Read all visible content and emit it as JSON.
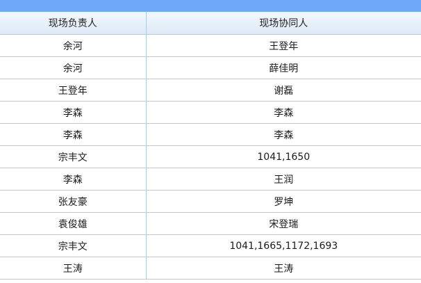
{
  "table": {
    "headers": [
      "现场负责人",
      "现场协同人"
    ],
    "rows": [
      [
        "余河",
        "王登年"
      ],
      [
        "余河",
        "薛佳明"
      ],
      [
        "王登年",
        "谢磊"
      ],
      [
        "李森",
        "李森"
      ],
      [
        "李森",
        "李森"
      ],
      [
        "宗丰文",
        "1041,1650"
      ],
      [
        "李森",
        "王润"
      ],
      [
        "张友豪",
        "罗坤"
      ],
      [
        "袁俊雄",
        "宋登瑞"
      ],
      [
        "宗丰文",
        "1041,1665,1172,1693"
      ],
      [
        "王涛",
        "王涛"
      ]
    ]
  },
  "colors": {
    "top_bar": "#6ea7f5",
    "header_bg": "#dde9f7",
    "grid_line": "#a9cdeb"
  }
}
